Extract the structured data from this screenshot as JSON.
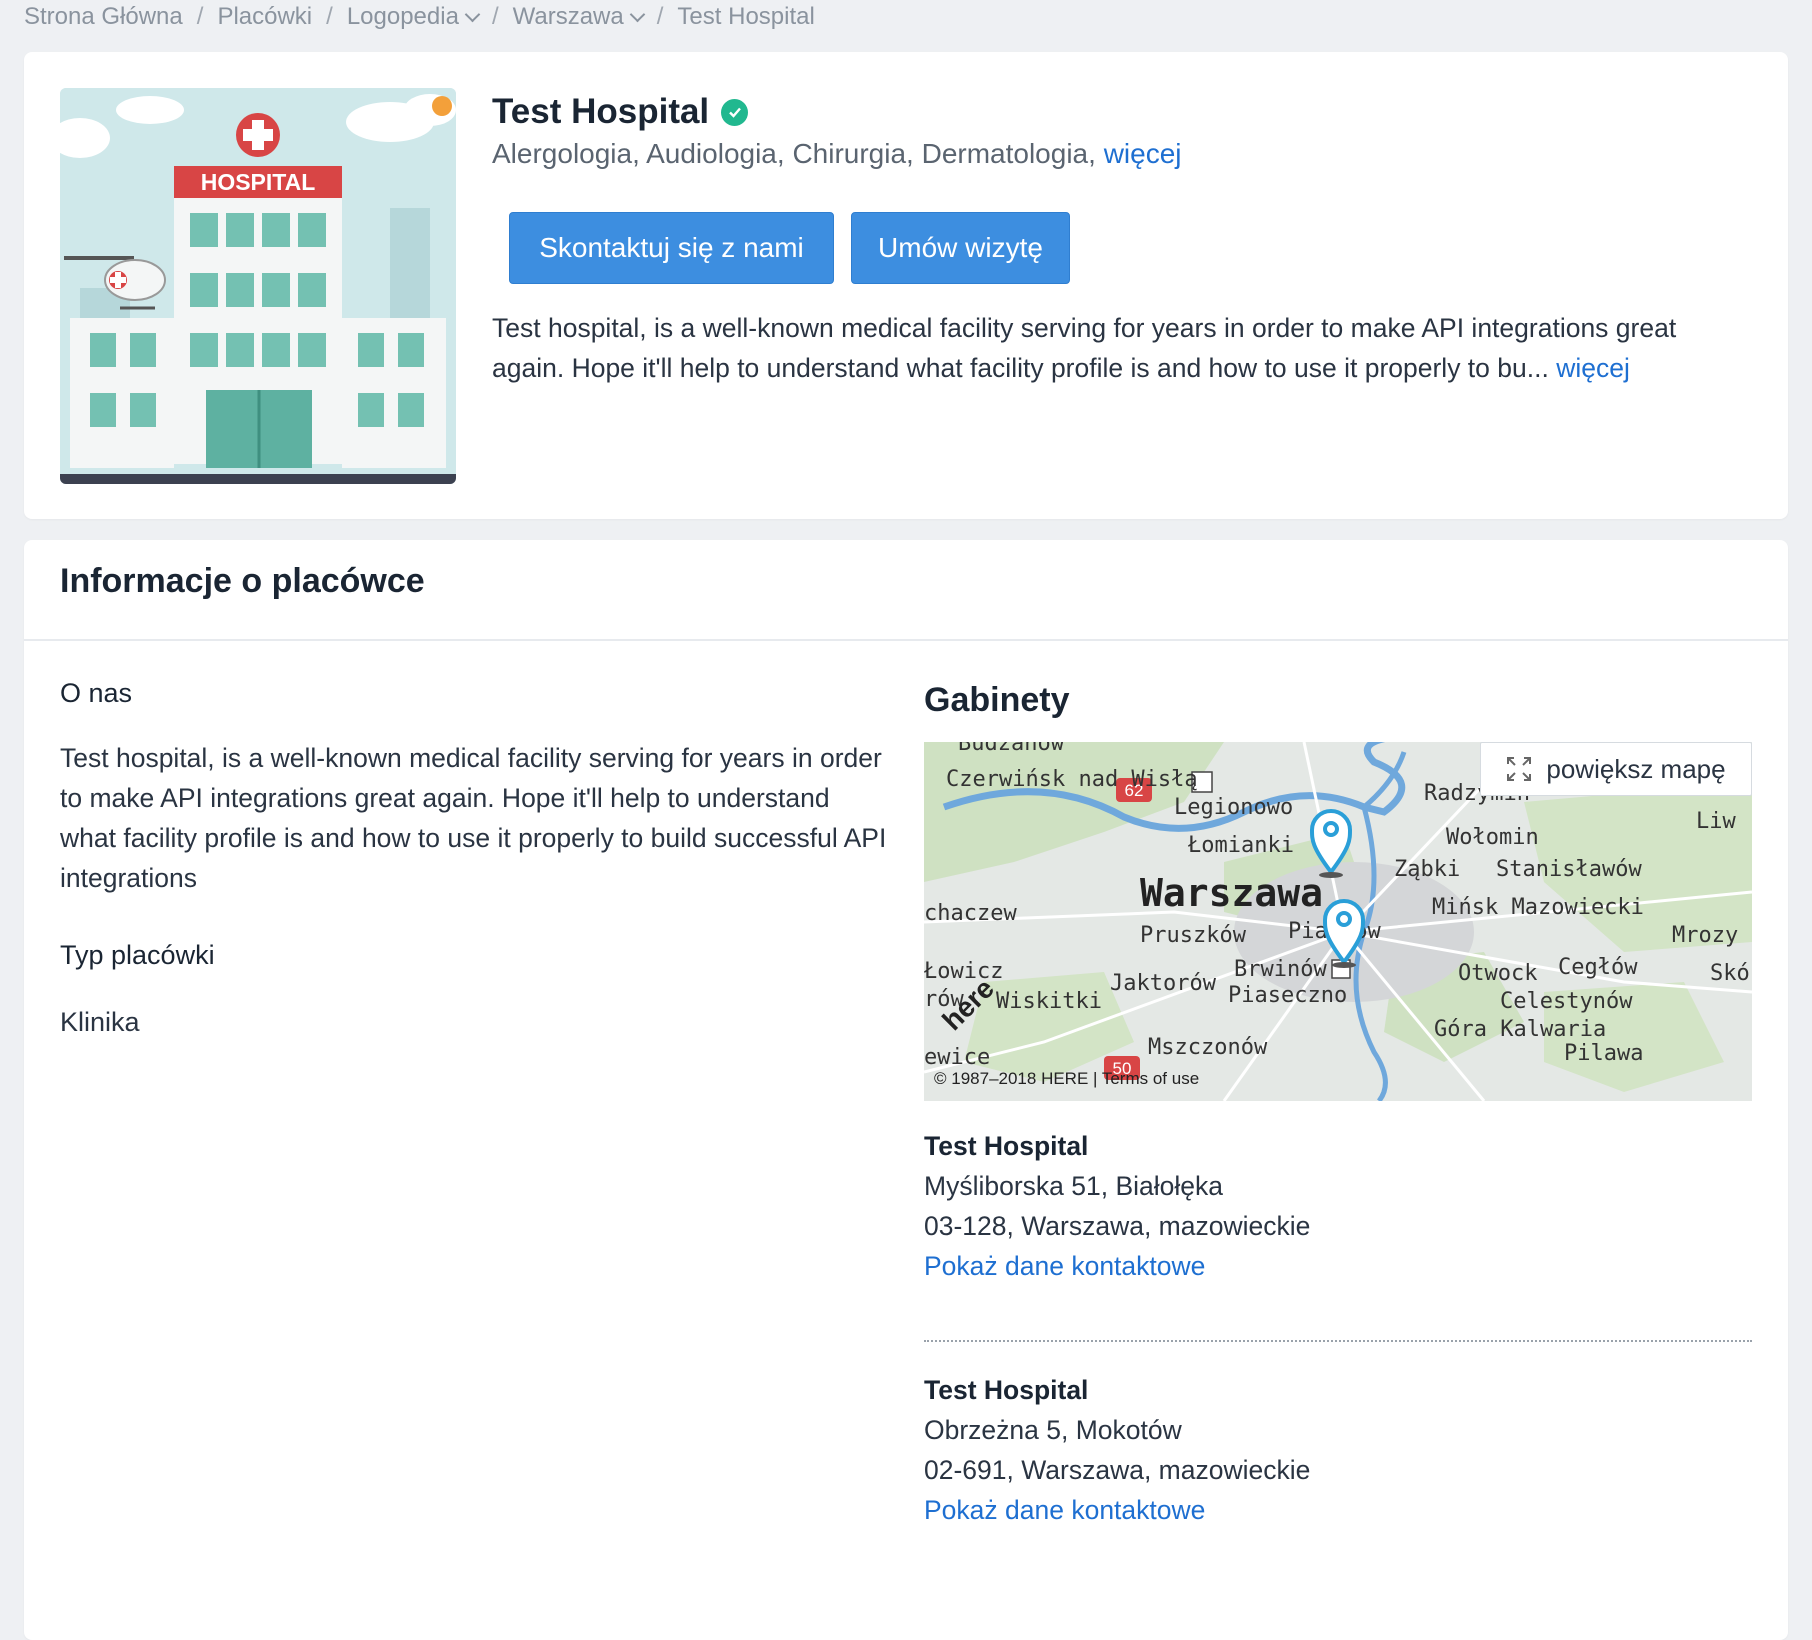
{
  "breadcrumb": [
    {
      "label": "Strona Główna",
      "dropdown": false
    },
    {
      "label": "Placówki",
      "dropdown": false
    },
    {
      "label": "Logopedia",
      "dropdown": true
    },
    {
      "label": "Warszawa",
      "dropdown": true
    },
    {
      "label": "Test Hospital",
      "dropdown": false
    }
  ],
  "facility": {
    "name": "Test Hospital",
    "image_sign": "HOSPITAL",
    "specialties": "Alergologia, Audiologia, Chirurgia, Dermatologia,",
    "specialties_more": "więcej",
    "contact_button": "Skontaktuj się z nami",
    "book_button": "Umów wizytę",
    "description": "Test hospital, is a well-known medical facility serving for years in order to make API integrations great again. Hope it'll help to understand what facility profile is and how to use it properly to bu...",
    "description_more": "więcej"
  },
  "info": {
    "header": "Informacje o placówce",
    "about_label": "O nas",
    "about_text": "Test hospital, is a well-known medical facility serving for years in order to make API integrations great again. Hope it'll help to understand what facility profile is and how to use it properly to build successful API integrations",
    "type_label": "Typ placówki",
    "type_value": "Klinika"
  },
  "offices": {
    "title": "Gabinety",
    "map_expand": "powiększ mapę",
    "map_copyright": "© 1987–2018 HERE | Terms of use",
    "map_labels": [
      "Budzanów",
      "Czerwińsk nad Wisłą",
      "62",
      "Legionowo",
      "Radzymin",
      "Liw",
      "Łomianki",
      "Wołomin",
      "Ząbki",
      "Stanisławów",
      "Warszawa",
      "chaczew",
      "Mińsk Mazowiecki",
      "Mrozy",
      "Pruszków",
      "Piastów",
      "Łowicz",
      "Brwinów",
      "Otwock",
      "Cegłów",
      "Skó",
      "rów",
      "Wiskitki",
      "Jaktorów",
      "Piaseczno",
      "Celestynów",
      "50",
      "Mszczonów",
      "Góra Kalwaria",
      "Pilawa",
      "ewice",
      "here"
    ],
    "list": [
      {
        "name": "Test Hospital",
        "street": "Myśliborska 51, Białołęka",
        "city": "03-128, Warszawa, mazowieckie",
        "link": "Pokaż dane kontaktowe"
      },
      {
        "name": "Test Hospital",
        "street": "Obrzeżna 5, Mokotów",
        "city": "02-691, Warszawa, mazowieckie",
        "link": "Pokaż dane kontaktowe"
      }
    ]
  },
  "colors": {
    "primary_button": "#3d8ee0",
    "link": "#1e6fd1",
    "verified": "#21b88f",
    "pin": "#2a9fd8"
  }
}
